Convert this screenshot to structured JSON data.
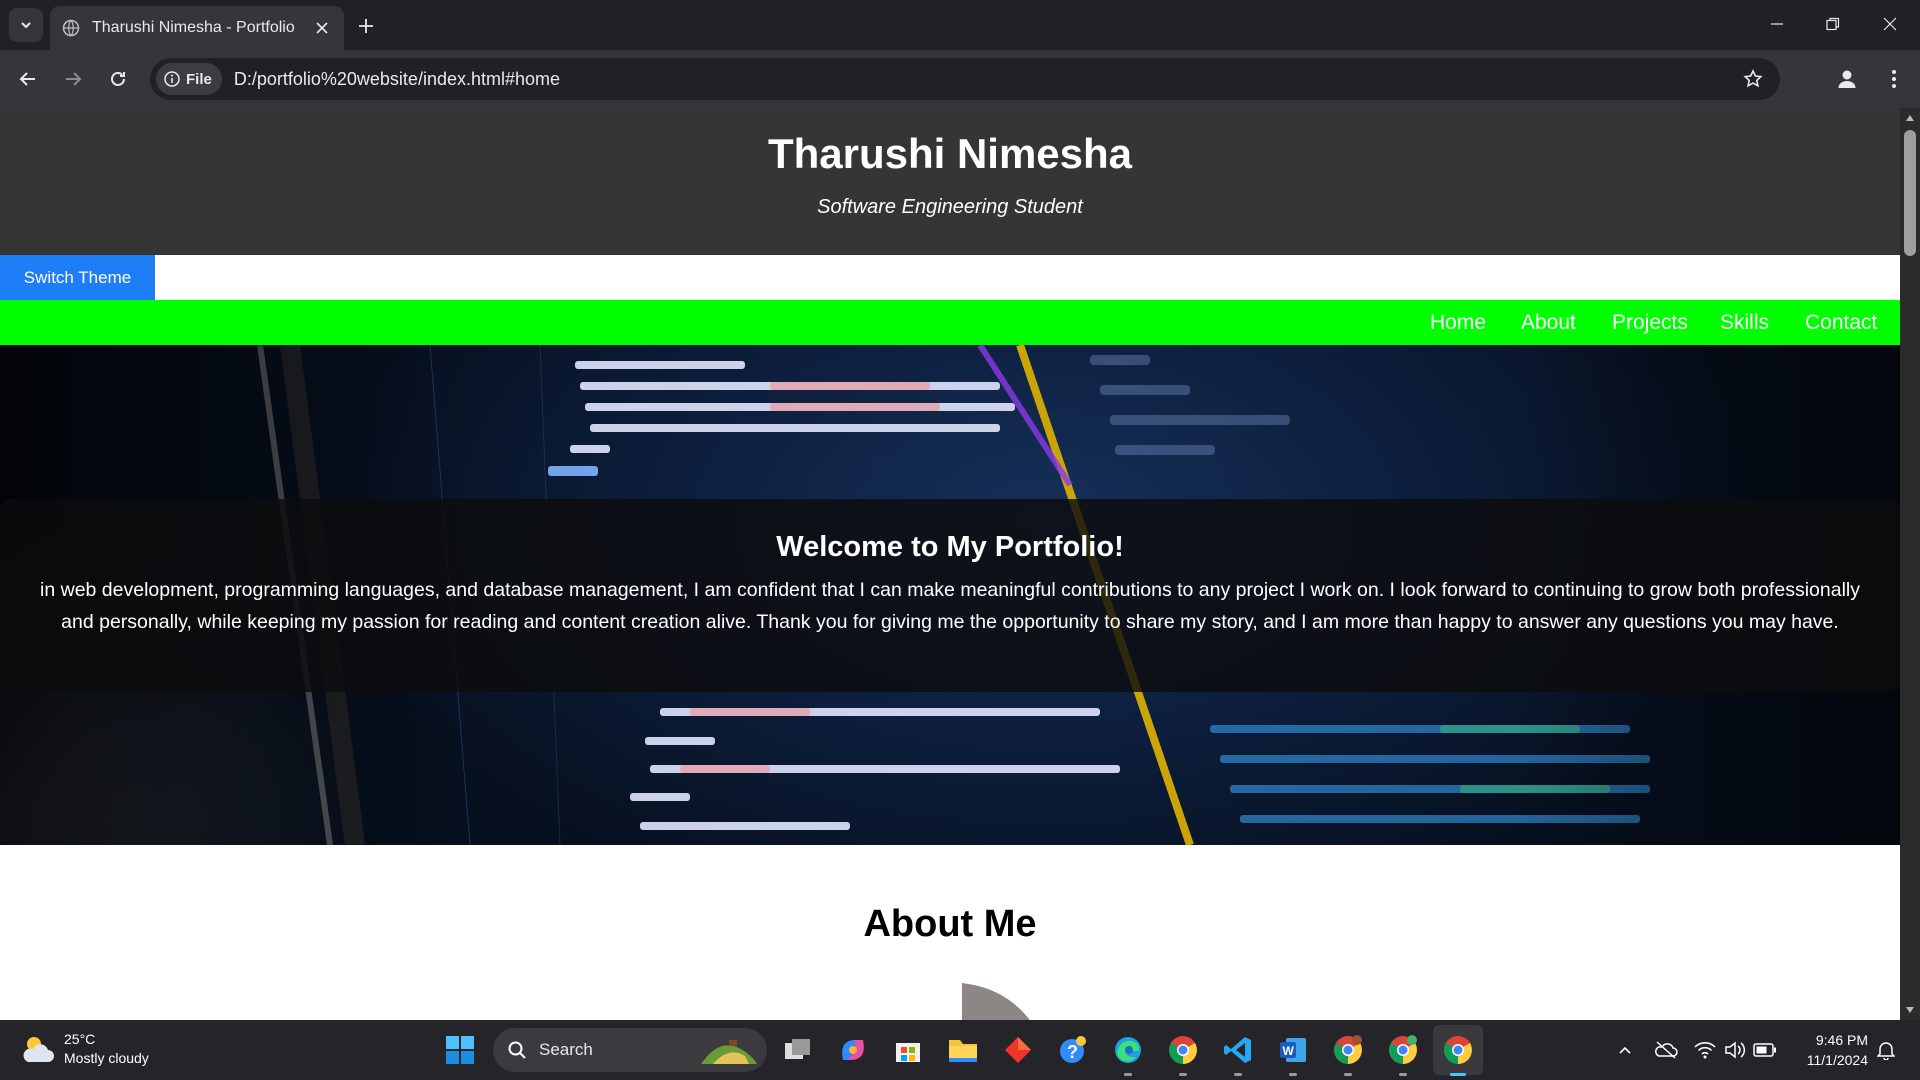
{
  "browser": {
    "tab_title": "Tharushi Nimesha - Portfolio",
    "site_chip": "File",
    "url": "D:/portfolio%20website/index.html#home"
  },
  "page": {
    "header": {
      "title": "Tharushi Nimesha",
      "subtitle": "Software Engineering Student"
    },
    "theme_button": "Switch Theme",
    "nav": [
      "Home",
      "About",
      "Projects",
      "Skills",
      "Contact"
    ],
    "hero": {
      "title": "Welcome to My Portfolio!",
      "text": "in web development, programming languages, and database management, I am confident that I can make meaningful contributions to any project I work on. I look forward to continuing to grow both professionally and personally, while keeping my passion for reading and content creation alive. Thank you for giving me the opportunity to share my story, and I am more than happy to answer any questions you may have."
    },
    "about_title": "About Me"
  },
  "taskbar": {
    "weather_temp": "25°C",
    "weather_desc": "Mostly cloudy",
    "search_label": "Search",
    "time": "9:46 PM",
    "date": "11/1/2024"
  },
  "colors": {
    "header_bg": "#353535",
    "theme_button": "#1e7ef8",
    "nav_bg": "#00ff00"
  }
}
